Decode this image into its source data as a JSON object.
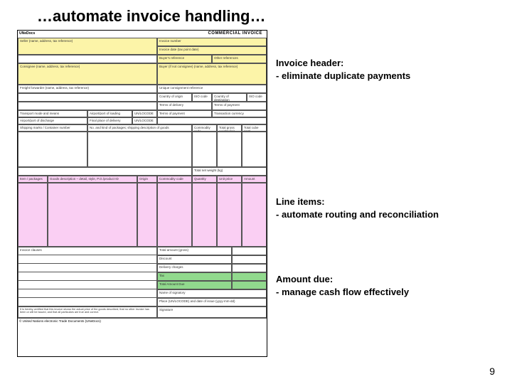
{
  "title": "…automate invoice handling…",
  "annotations": {
    "header": {
      "title": "Invoice header:",
      "bullet": " - eliminate duplicate payments"
    },
    "lines": {
      "title": "Line items:",
      "bullet": " - automate routing and reconciliation"
    },
    "amount": {
      "title": "Amount due:",
      "bullet": " - manage cash flow effectively"
    }
  },
  "page_number": "9",
  "invoice": {
    "brand": "UNeDocs",
    "doc_title": "COMMERCIAL INVOICE",
    "fields": {
      "seller": "Seller (name, address, tax reference)",
      "inv_no": "Invoice number",
      "inv_date": "Invoice date (tax point date)",
      "buyer_ref": "Buyer's reference",
      "other_ref": "Other references",
      "consignee": "Consignee (name, address, tax reference)",
      "buyer": "Buyer (if not consignee) (name, address, tax reference)",
      "freight": "Freight forwarder (name, address, tax reference)",
      "ucr": "Unique consignment reference",
      "coo": "Country of origin",
      "iso": "ISO code",
      "cod": "Country of destination",
      "terms_delivery": "Terms of delivery",
      "terms_payment": "Terms of payment",
      "transport": "Transport mode and means",
      "loading_port": "Airport/port of loading",
      "unlocode": "UN/LOCODE",
      "currency": "Transaction currency",
      "discharge": "Airport/port of discharge",
      "delivery_place": "Final place of delivery",
      "shipping_marks": "Shipping marks / Container number",
      "packages": "No. and kind of packages; shipping description of goods",
      "commodity": "Commodity code",
      "gross_weight": "Total gross weight (kg)",
      "cube": "Total cube (m3)",
      "net_weight": "Total net weight (kg)",
      "item_no": "Item / packages",
      "desc": "Goods description – detail, style, P.O./product ID",
      "origin": "Origin",
      "comm_code": "Commodity code",
      "qty": "Quantity",
      "unit_price": "Unit price",
      "amount": "Amount",
      "clauses": "Invoice clauses",
      "total_gross": "Total amount (gross)",
      "discount": "Discount",
      "delivery_chg": "Delivery charges",
      "tax": "Tax",
      "total_due": "Total Amount Due",
      "signatory": "Name of signatory",
      "place_date": "Place (UN/LOCODE) and date of issue (yyyy-mm-dd)",
      "signature": "Signature",
      "cert": "It is hereby certified that this invoice shows the actual price of the goods described; that no other invoice has been or will be issued, and that all particulars are true and correct.",
      "footer": "© United Nations electronic Trade Documents (UNeDocs)"
    }
  }
}
